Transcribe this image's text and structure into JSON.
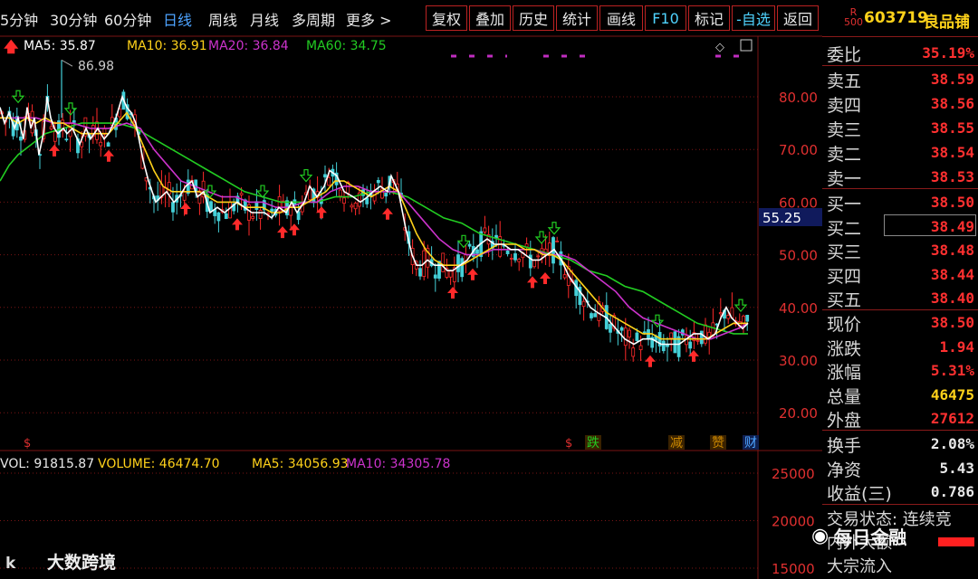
{
  "toolbar": {
    "periods": [
      "5分钟",
      "30分钟",
      "60分钟",
      "日线",
      "周线",
      "月线",
      "多周期",
      "更多 >"
    ],
    "active_period": "日线",
    "buttons": [
      "复权",
      "叠加",
      "历史",
      "统计",
      "画线",
      "F10",
      "标记",
      "-自选",
      "返回"
    ]
  },
  "ma_legend": {
    "ma5": "MA5: 35.87",
    "ma10": "MA10: 36.91",
    "ma20": "MA20: 36.84",
    "ma60": "MA60: 34.75"
  },
  "colors": {
    "ma5": "#ffffff",
    "ma10": "#ffd21a",
    "ma20": "#cc33cc",
    "ma60": "#22cc22",
    "up": "#ff2a2a",
    "down": "#44d0d8",
    "grid": "#7a1515"
  },
  "chart_data": {
    "type": "line",
    "price_axis": {
      "ticks": [
        20,
        30,
        40,
        50,
        60,
        70,
        80
      ],
      "labels": [
        "20.00",
        "30.00",
        "40.00",
        "50.00",
        "60.00",
        "70.00",
        "80.00"
      ]
    },
    "high_marker": "86.98",
    "current_price_tag": "55.25",
    "event_labels": [
      "$",
      "$",
      "跌",
      "减",
      "赞",
      "财"
    ],
    "ma5": [
      [
        0,
        78
      ],
      [
        5,
        75
      ],
      [
        10,
        77
      ],
      [
        16,
        74
      ],
      [
        20,
        76
      ],
      [
        26,
        72
      ],
      [
        30,
        78
      ],
      [
        34,
        74
      ],
      [
        38,
        76
      ],
      [
        43,
        69
      ],
      [
        48,
        73
      ],
      [
        52,
        80
      ],
      [
        56,
        76
      ],
      [
        60,
        74
      ],
      [
        64,
        73
      ],
      [
        70,
        74
      ],
      [
        74,
        73
      ],
      [
        80,
        74
      ],
      [
        88,
        71
      ],
      [
        95,
        74
      ],
      [
        100,
        72
      ],
      [
        108,
        74
      ],
      [
        115,
        72
      ],
      [
        120,
        73
      ],
      [
        128,
        76
      ],
      [
        135,
        80
      ],
      [
        140,
        78
      ],
      [
        145,
        77
      ],
      [
        150,
        75
      ],
      [
        158,
        68
      ],
      [
        164,
        64
      ],
      [
        168,
        62
      ],
      [
        172,
        60
      ],
      [
        178,
        61
      ],
      [
        184,
        62
      ],
      [
        192,
        60
      ],
      [
        198,
        61
      ],
      [
        205,
        63
      ],
      [
        212,
        64
      ],
      [
        218,
        61
      ],
      [
        225,
        62
      ],
      [
        232,
        58
      ],
      [
        240,
        59
      ],
      [
        248,
        58
      ],
      [
        255,
        59
      ],
      [
        262,
        60
      ],
      [
        270,
        59
      ],
      [
        278,
        58
      ],
      [
        285,
        58
      ],
      [
        292,
        58
      ],
      [
        300,
        57
      ],
      [
        308,
        59
      ],
      [
        316,
        58
      ],
      [
        322,
        60
      ],
      [
        328,
        58
      ],
      [
        336,
        60
      ],
      [
        342,
        63
      ],
      [
        350,
        61
      ],
      [
        358,
        63
      ],
      [
        364,
        66
      ],
      [
        372,
        65
      ],
      [
        380,
        62
      ],
      [
        390,
        61
      ],
      [
        398,
        60
      ],
      [
        406,
        61
      ],
      [
        412,
        62
      ],
      [
        420,
        63
      ],
      [
        428,
        62
      ],
      [
        432,
        65
      ],
      [
        440,
        62
      ],
      [
        448,
        55
      ],
      [
        455,
        50
      ],
      [
        460,
        48
      ],
      [
        466,
        48
      ],
      [
        472,
        49
      ],
      [
        480,
        48
      ],
      [
        488,
        48
      ],
      [
        494,
        47
      ],
      [
        500,
        47
      ],
      [
        508,
        48
      ],
      [
        516,
        49
      ],
      [
        524,
        51
      ],
      [
        530,
        52
      ],
      [
        538,
        53
      ],
      [
        546,
        52
      ],
      [
        556,
        52
      ],
      [
        564,
        51
      ],
      [
        572,
        51
      ],
      [
        580,
        50
      ],
      [
        588,
        49
      ],
      [
        596,
        49
      ],
      [
        604,
        50
      ],
      [
        612,
        51
      ],
      [
        620,
        49
      ],
      [
        628,
        46
      ],
      [
        636,
        44
      ],
      [
        645,
        42
      ],
      [
        652,
        40
      ],
      [
        660,
        39
      ],
      [
        670,
        38
      ],
      [
        680,
        36
      ],
      [
        690,
        34
      ],
      [
        700,
        33
      ],
      [
        710,
        34
      ],
      [
        720,
        34
      ],
      [
        730,
        33
      ],
      [
        740,
        33
      ],
      [
        750,
        33
      ],
      [
        758,
        34
      ],
      [
        766,
        35
      ],
      [
        774,
        35
      ],
      [
        782,
        34
      ],
      [
        790,
        35
      ],
      [
        796,
        38
      ],
      [
        802,
        40
      ],
      [
        808,
        38
      ],
      [
        814,
        37
      ],
      [
        820,
        36
      ],
      [
        826,
        37
      ]
    ],
    "ma10": [
      [
        0,
        76
      ],
      [
        10,
        76
      ],
      [
        20,
        75
      ],
      [
        30,
        76
      ],
      [
        40,
        75
      ],
      [
        50,
        76
      ],
      [
        60,
        75
      ],
      [
        70,
        75
      ],
      [
        80,
        74
      ],
      [
        90,
        73
      ],
      [
        100,
        73
      ],
      [
        110,
        73
      ],
      [
        120,
        73
      ],
      [
        130,
        75
      ],
      [
        140,
        77
      ],
      [
        150,
        74
      ],
      [
        160,
        70
      ],
      [
        170,
        66
      ],
      [
        180,
        63
      ],
      [
        190,
        62
      ],
      [
        200,
        62
      ],
      [
        210,
        62
      ],
      [
        220,
        62
      ],
      [
        230,
        61
      ],
      [
        240,
        60
      ],
      [
        250,
        60
      ],
      [
        260,
        60
      ],
      [
        270,
        59
      ],
      [
        280,
        59
      ],
      [
        290,
        59
      ],
      [
        300,
        58
      ],
      [
        310,
        58
      ],
      [
        320,
        59
      ],
      [
        330,
        59
      ],
      [
        340,
        60
      ],
      [
        350,
        61
      ],
      [
        360,
        62
      ],
      [
        370,
        64
      ],
      [
        380,
        64
      ],
      [
        390,
        63
      ],
      [
        400,
        62
      ],
      [
        410,
        61
      ],
      [
        420,
        62
      ],
      [
        430,
        63
      ],
      [
        440,
        62
      ],
      [
        450,
        58
      ],
      [
        460,
        54
      ],
      [
        470,
        51
      ],
      [
        480,
        49
      ],
      [
        490,
        48
      ],
      [
        500,
        48
      ],
      [
        510,
        48
      ],
      [
        520,
        49
      ],
      [
        530,
        50
      ],
      [
        540,
        51
      ],
      [
        550,
        52
      ],
      [
        560,
        52
      ],
      [
        570,
        52
      ],
      [
        580,
        51
      ],
      [
        590,
        51
      ],
      [
        600,
        50
      ],
      [
        610,
        50
      ],
      [
        620,
        49
      ],
      [
        630,
        47
      ],
      [
        640,
        45
      ],
      [
        650,
        43
      ],
      [
        660,
        41
      ],
      [
        670,
        39
      ],
      [
        680,
        38
      ],
      [
        690,
        37
      ],
      [
        700,
        36
      ],
      [
        710,
        35
      ],
      [
        720,
        35
      ],
      [
        730,
        34
      ],
      [
        740,
        34
      ],
      [
        750,
        34
      ],
      [
        760,
        34
      ],
      [
        770,
        34
      ],
      [
        780,
        34
      ],
      [
        790,
        35
      ],
      [
        800,
        36
      ],
      [
        810,
        37
      ],
      [
        820,
        37
      ],
      [
        826,
        37
      ]
    ],
    "ma20": [
      [
        0,
        76
      ],
      [
        20,
        76
      ],
      [
        40,
        76
      ],
      [
        60,
        75
      ],
      [
        80,
        75
      ],
      [
        100,
        74
      ],
      [
        120,
        74
      ],
      [
        140,
        75
      ],
      [
        155,
        74
      ],
      [
        170,
        70
      ],
      [
        185,
        67
      ],
      [
        200,
        64
      ],
      [
        215,
        63
      ],
      [
        230,
        62
      ],
      [
        245,
        61
      ],
      [
        260,
        61
      ],
      [
        275,
        60
      ],
      [
        290,
        60
      ],
      [
        305,
        59
      ],
      [
        320,
        59
      ],
      [
        335,
        60
      ],
      [
        350,
        60
      ],
      [
        365,
        62
      ],
      [
        380,
        63
      ],
      [
        395,
        63
      ],
      [
        410,
        62
      ],
      [
        425,
        62
      ],
      [
        440,
        62
      ],
      [
        455,
        59
      ],
      [
        470,
        56
      ],
      [
        485,
        53
      ],
      [
        500,
        51
      ],
      [
        515,
        50
      ],
      [
        530,
        50
      ],
      [
        545,
        51
      ],
      [
        560,
        51
      ],
      [
        575,
        51
      ],
      [
        590,
        51
      ],
      [
        605,
        50
      ],
      [
        620,
        50
      ],
      [
        635,
        49
      ],
      [
        650,
        47
      ],
      [
        665,
        45
      ],
      [
        680,
        43
      ],
      [
        695,
        40
      ],
      [
        710,
        38
      ],
      [
        725,
        37
      ],
      [
        740,
        36
      ],
      [
        755,
        35
      ],
      [
        770,
        34
      ],
      [
        785,
        34
      ],
      [
        800,
        35
      ],
      [
        815,
        36
      ],
      [
        826,
        37
      ]
    ],
    "ma60": [
      [
        0,
        64
      ],
      [
        10,
        67
      ],
      [
        20,
        69
      ],
      [
        35,
        71
      ],
      [
        50,
        73
      ],
      [
        70,
        74
      ],
      [
        90,
        75
      ],
      [
        110,
        75
      ],
      [
        130,
        75
      ],
      [
        150,
        74
      ],
      [
        170,
        72
      ],
      [
        190,
        70
      ],
      [
        210,
        68
      ],
      [
        230,
        66
      ],
      [
        250,
        64
      ],
      [
        270,
        62
      ],
      [
        290,
        61
      ],
      [
        310,
        60
      ],
      [
        330,
        60
      ],
      [
        350,
        60
      ],
      [
        370,
        61
      ],
      [
        390,
        61
      ],
      [
        410,
        62
      ],
      [
        430,
        62
      ],
      [
        450,
        61
      ],
      [
        470,
        59
      ],
      [
        490,
        57
      ],
      [
        510,
        56
      ],
      [
        530,
        54
      ],
      [
        550,
        53
      ],
      [
        570,
        52
      ],
      [
        590,
        51
      ],
      [
        610,
        50
      ],
      [
        630,
        49
      ],
      [
        650,
        47
      ],
      [
        670,
        46
      ],
      [
        690,
        44
      ],
      [
        710,
        43
      ],
      [
        730,
        41
      ],
      [
        750,
        39
      ],
      [
        770,
        37
      ],
      [
        790,
        36
      ],
      [
        810,
        35
      ],
      [
        826,
        35
      ]
    ],
    "volume_labels": [
      "VOL: 91815.87",
      "VOLUME: 46474.70",
      "MA5: 34056.93",
      "MA10: 34305.78"
    ],
    "volume_axis": {
      "ticks": [
        15000,
        20000,
        25000
      ],
      "labels": [
        "15000",
        "20000",
        "25000"
      ]
    }
  },
  "panel": {
    "code_prefix": "R\n500",
    "code": "603719",
    "name": "良品铺",
    "weibi": {
      "label": "委比",
      "value": "35.19%"
    },
    "asks": [
      {
        "label": "卖五",
        "value": "38.59"
      },
      {
        "label": "卖四",
        "value": "38.56"
      },
      {
        "label": "卖三",
        "value": "38.55"
      },
      {
        "label": "卖二",
        "value": "38.54"
      },
      {
        "label": "卖一",
        "value": "38.53"
      }
    ],
    "bids": [
      {
        "label": "买一",
        "value": "38.50"
      },
      {
        "label": "买二",
        "value": "38.49"
      },
      {
        "label": "买三",
        "value": "38.48"
      },
      {
        "label": "买四",
        "value": "38.44"
      },
      {
        "label": "买五",
        "value": "38.40"
      }
    ],
    "stats": [
      {
        "label": "现价",
        "value": "38.50"
      },
      {
        "label": "涨跌",
        "value": "1.94"
      },
      {
        "label": "涨幅",
        "value": "5.31%"
      },
      {
        "label": "总量",
        "value": "46475"
      },
      {
        "label": "外盘",
        "value": "27612"
      }
    ],
    "stats2": [
      {
        "label": "换手",
        "value": "2.08%"
      },
      {
        "label": "净资",
        "value": "5.43"
      },
      {
        "label": "收益(三)",
        "value": "0.786"
      }
    ],
    "bottom": [
      "交易状态: 连续竞",
      "内外大额",
      "大宗流入"
    ]
  },
  "watermarks": {
    "left": "大数跨境",
    "right": "每日金融"
  }
}
